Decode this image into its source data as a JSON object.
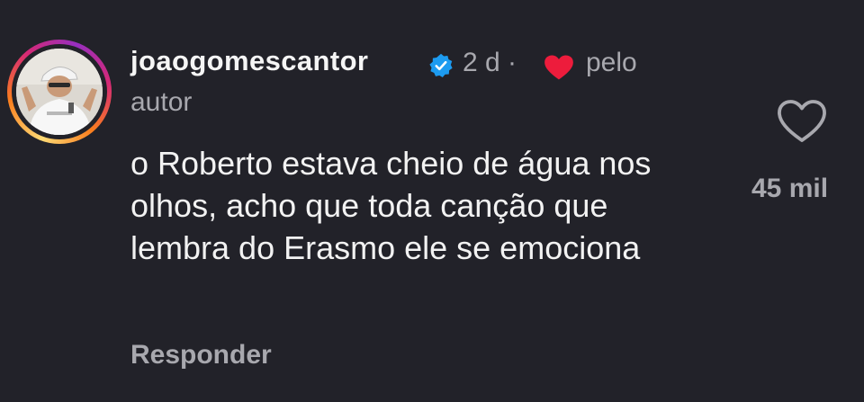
{
  "comment": {
    "username": "joaogomescantor",
    "verified": true,
    "time": "2 d ·",
    "liked_by_author_prefix": "pelo",
    "liked_by_author_suffix": "autor",
    "text": "o Roberto estava cheio de água nos olhos, acho que toda canção que lembra do Erasmo ele se emociona",
    "reply_label": "Responder",
    "like_count": "45 mil"
  },
  "icons": {
    "verified": "verified-badge-icon",
    "author_heart": "heart-filled-icon",
    "like": "heart-outline-icon"
  },
  "colors": {
    "background": "#222229",
    "verified_blue": "#1d9bf0",
    "heart_red": "#ed1c3c",
    "secondary_text": "#a8a8ae"
  }
}
